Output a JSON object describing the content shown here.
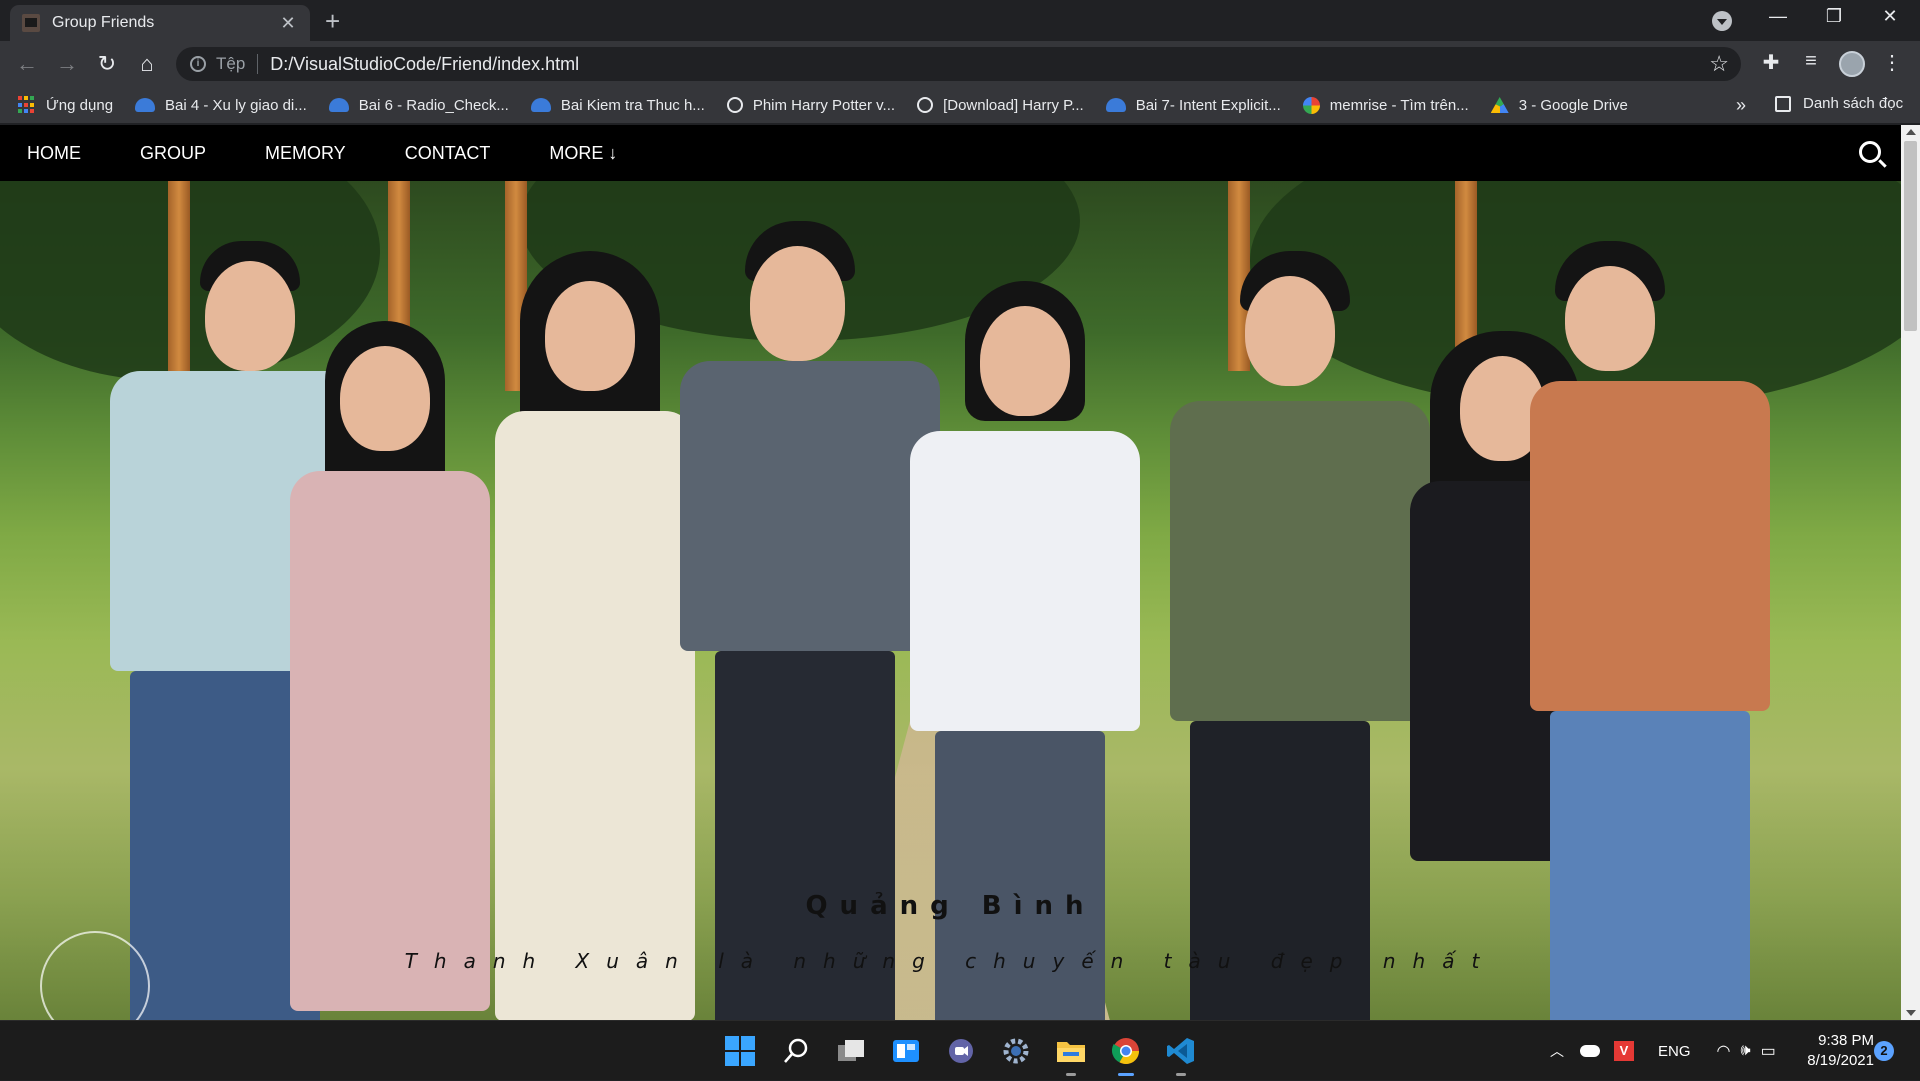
{
  "browser": {
    "tab": {
      "title": "Group Friends",
      "close": "✕"
    },
    "new_tab": "+",
    "window_controls": {
      "minimize": "—",
      "restore": "❐",
      "close": "✕"
    },
    "omnibox": {
      "scheme_label": "Tệp",
      "url": "D:/VisualStudioCode/Friend/index.html"
    },
    "bookmarks": [
      {
        "label": "Ứng dụng",
        "icon": "apps-grid-icon"
      },
      {
        "label": "Bai 4 - Xu ly giao di...",
        "icon": "cloud-icon"
      },
      {
        "label": "Bai 6 - Radio_Check...",
        "icon": "cloud-icon"
      },
      {
        "label": "Bai Kiem tra Thuc h...",
        "icon": "cloud-icon"
      },
      {
        "label": "Phim Harry Potter v...",
        "icon": "globe-icon"
      },
      {
        "label": "[Download] Harry P...",
        "icon": "globe-icon"
      },
      {
        "label": "Bai 7- Intent Explicit...",
        "icon": "cloud-icon"
      },
      {
        "label": "memrise - Tìm trên...",
        "icon": "google-icon"
      },
      {
        "label": "3 - Google Drive",
        "icon": "drive-icon"
      }
    ],
    "bookmarks_overflow": "»",
    "reading_list": "Danh sách đọc"
  },
  "site": {
    "nav": [
      "HOME",
      "GROUP",
      "MEMORY",
      "CONTACT",
      "MORE ↓"
    ],
    "hero_title": "Quảng Bình",
    "hero_subtitle": "Thanh Xuân là những chuyến tàu đẹp nhất"
  },
  "taskbar": {
    "language": "ENG",
    "time": "9:38 PM",
    "date": "8/19/2021",
    "notifications": "2"
  }
}
